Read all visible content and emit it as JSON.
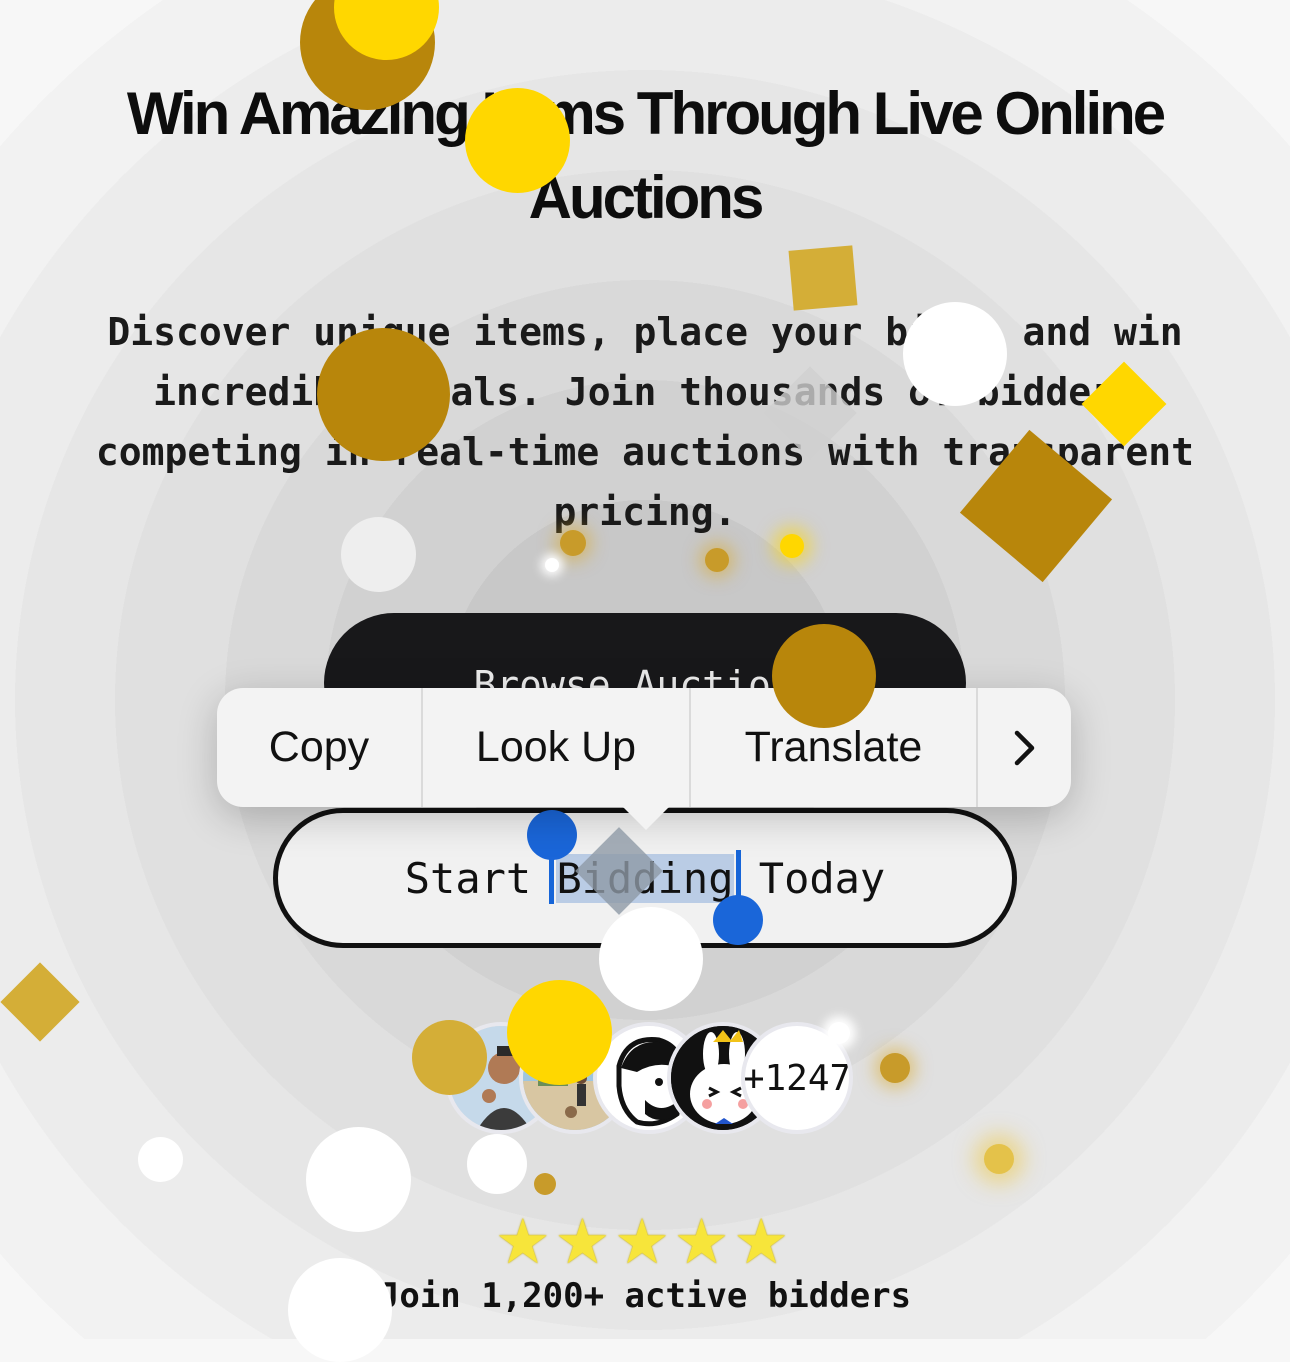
{
  "hero": {
    "title": "Win Amazing Items Through Live Online Auctions",
    "subtitle": "Discover unique items, place your bids, and win incredible deals. Join thousands of bidders competing in real-time auctions with transparent pricing."
  },
  "buttons": {
    "browse_label": "Browse Auctions",
    "start_prefix": "Start ",
    "start_selected": "Bidding",
    "start_suffix": " Today"
  },
  "context_menu": {
    "items": [
      "Copy",
      "Look Up",
      "Translate"
    ],
    "more_icon": "chevron-right-icon"
  },
  "social_proof": {
    "extra_count": "+1247",
    "stars_shown": 5,
    "text": "Join 1,200+ active bidders"
  },
  "colors": {
    "confetti_gold": "#b8860b",
    "confetti_yellow": "#ffd700",
    "selection_blue": "#1a66d9",
    "dark_button": "#18181a"
  }
}
